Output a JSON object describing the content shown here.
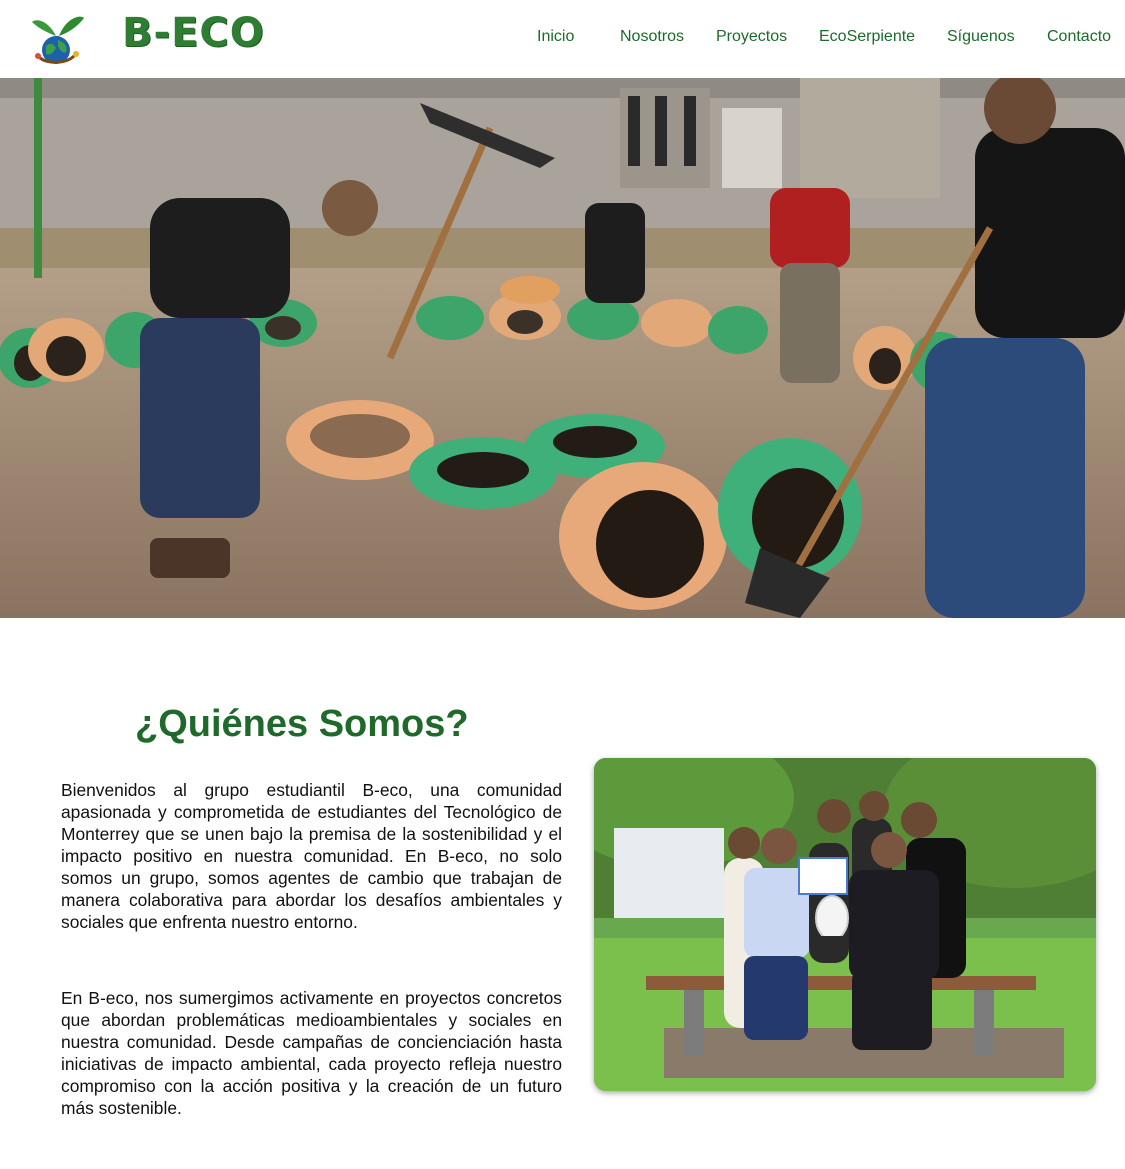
{
  "header": {
    "brand": "B-ECO",
    "nav": [
      {
        "label": "Inicio"
      },
      {
        "label": "Nosotros"
      },
      {
        "label": "Proyectos"
      },
      {
        "label": "EcoSerpiente"
      },
      {
        "label": "Síguenos"
      },
      {
        "label": "Contacto"
      }
    ]
  },
  "about": {
    "title": "¿Quiénes Somos?",
    "paragraphs": [
      "Bienvenidos al grupo estudiantil B-eco, una comunidad apasionada y comprometida de estudiantes del Tecnológico de Monterrey que se unen bajo la premisa de la sostenibilidad y el impacto positivo en nuestra comunidad. En B-eco, no solo somos un grupo, somos agentes de cambio que trabajan de manera colaborativa para abordar los desafíos ambientales y sociales que enfrenta nuestro entorno.",
      "En B-eco, nos sumergimos activamente en proyectos concretos que abordan problemáticas medioambientales y sociales en nuestra comunidad. Desde campañas de concienciación hasta iniciativas de impacto ambiental, cada proyecto refleja nuestro compromiso con la acción positiva y la creación de un futuro más sostenible."
    ]
  },
  "colors": {
    "brand_green": "#2e7d32",
    "nav_green": "#1b6b2a",
    "title_green": "#1f6a2b"
  }
}
